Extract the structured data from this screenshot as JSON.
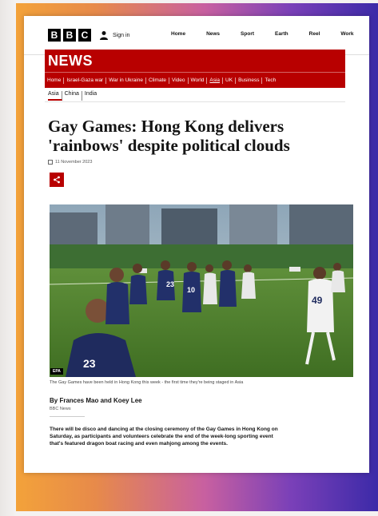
{
  "brand": {
    "logo_letters": [
      "B",
      "B",
      "C"
    ],
    "section": "NEWS",
    "red": "#b80000",
    "frame_colors": [
      "#f3a23a",
      "#c860a0",
      "#3c2aa8"
    ]
  },
  "account": {
    "signin_label": "Sign in",
    "icon": "user-icon"
  },
  "top_nav": [
    "Home",
    "News",
    "Sport",
    "Earth",
    "Reel",
    "Work"
  ],
  "sub_nav": [
    "Home",
    "Israel-Gaza war",
    "War in Ukraine",
    "Climate",
    "Video",
    "World",
    "Asia",
    "UK",
    "Business",
    "Tech"
  ],
  "sub_nav_active": "Asia",
  "regions": [
    "Asia",
    "China",
    "India"
  ],
  "article": {
    "headline": "Gay Games: Hong Kong delivers 'rainbows' despite political clouds",
    "date": "11 November 2023",
    "share_icon": "share-icon",
    "image_credit": "EPA",
    "caption": "The Gay Games have been held in Hong Kong this week - the first time they're being staged in Asia",
    "byline": "By Frances Mao and Koey Lee",
    "source": "BBC News",
    "lead": "There will be disco and dancing at the closing ceremony of the Gay Games in Hong Kong on Saturday, as participants and volunteers celebrate the end of the week-long sporting event that's featured dragon boat racing and even mahjong among the events."
  },
  "photo": {
    "shirt_numbers": [
      "23",
      "10",
      "49",
      "23"
    ]
  }
}
